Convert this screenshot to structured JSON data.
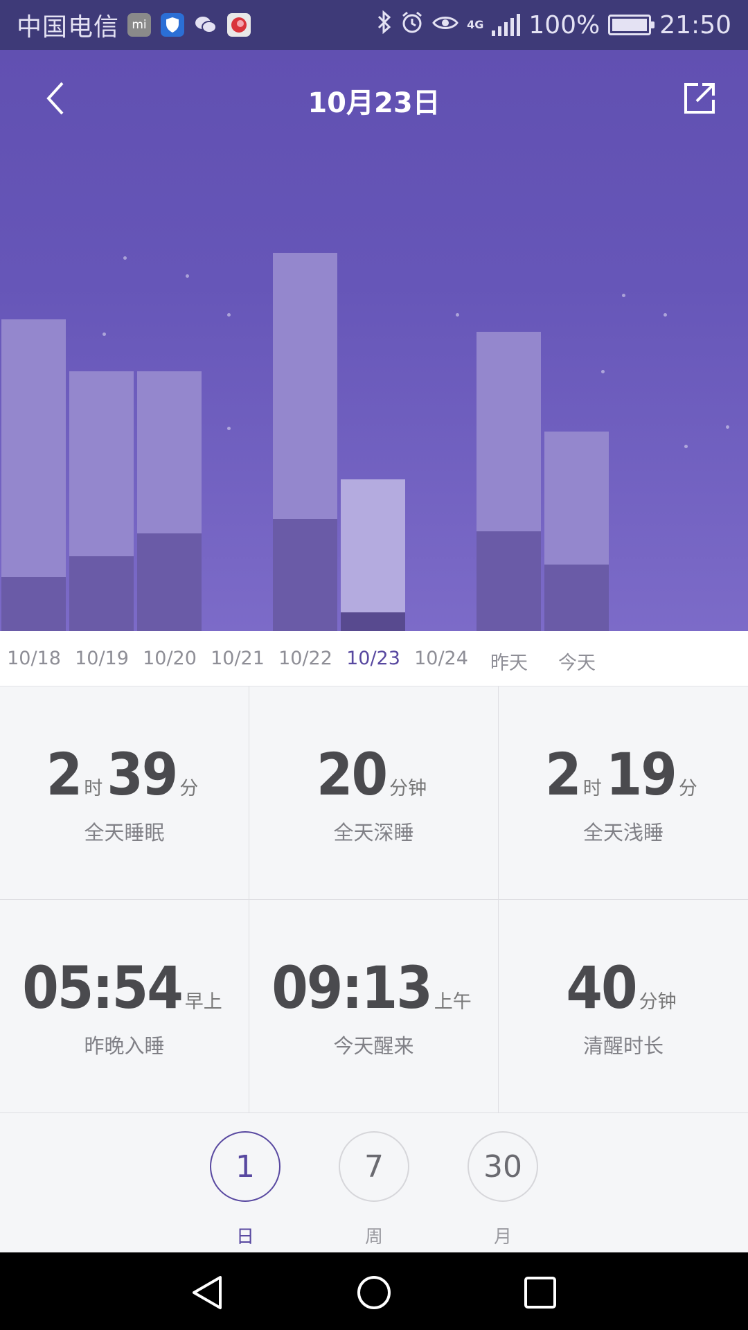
{
  "status_bar": {
    "carrier": "中国电信",
    "network": "4G",
    "battery": "100%",
    "time": "21:50",
    "icons": [
      "mi-icon",
      "shield-icon",
      "wechat-icon",
      "app-icon",
      "bluetooth-icon",
      "alarm-icon",
      "eye-icon",
      "signal-icon",
      "battery-icon"
    ]
  },
  "header": {
    "title": "10月23日"
  },
  "chart_data": {
    "type": "bar",
    "stacked": true,
    "categories": [
      "10/18",
      "10/19",
      "10/20",
      "10/21",
      "10/22",
      "10/23",
      "10/24",
      "昨天",
      "今天"
    ],
    "series": [
      {
        "values": [
          0.26,
          0.36,
          0.47,
          0,
          0.54,
          0.09,
          0,
          0.48,
          0.32
        ]
      },
      {
        "values": [
          1.24,
          0.89,
          0.78,
          0,
          1.28,
          0.64,
          0,
          0.96,
          0.64
        ]
      }
    ],
    "selected": "10/23",
    "colors": {
      "deep": "#6a5ba7",
      "light": "#9487cd",
      "selected_deep": "#584a8f",
      "selected_light": "#b4abdf"
    }
  },
  "stats": {
    "total": {
      "hours": "2",
      "hour_unit": "时",
      "minutes": "39",
      "minute_unit": "分",
      "label": "全天睡眠"
    },
    "deep": {
      "minutes": "20",
      "unit": "分钟",
      "label": "全天深睡"
    },
    "light": {
      "hours": "2",
      "hour_unit": "时",
      "minutes": "19",
      "minute_unit": "分",
      "label": "全天浅睡"
    },
    "bedtime": {
      "time": "05:54",
      "suffix": "早上",
      "label": "昨晚入睡"
    },
    "wake": {
      "time": "09:13",
      "suffix": "上午",
      "label": "今天醒来"
    },
    "awake": {
      "minutes": "40",
      "unit": "分钟",
      "label": "清醒时长"
    }
  },
  "period_selector": {
    "items": [
      {
        "value": "1",
        "label": "日",
        "active": true
      },
      {
        "value": "7",
        "label": "周",
        "active": false
      },
      {
        "value": "30",
        "label": "月",
        "active": false
      }
    ]
  },
  "colors": {
    "accent": "#5848a0",
    "header_bg": "#6150b1",
    "status_bg": "#3e3a78"
  }
}
